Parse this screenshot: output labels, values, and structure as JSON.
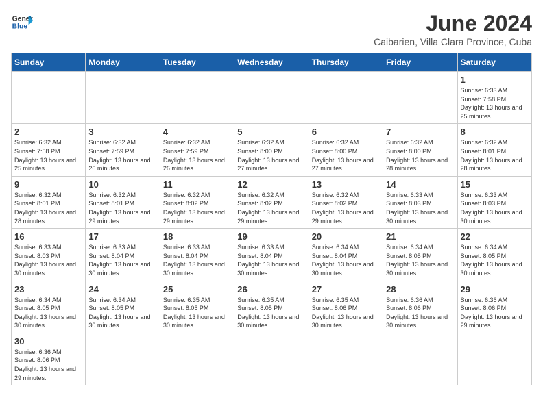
{
  "logo": {
    "text_general": "General",
    "text_blue": "Blue"
  },
  "title": "June 2024",
  "subtitle": "Caibarien, Villa Clara Province, Cuba",
  "days_of_week": [
    "Sunday",
    "Monday",
    "Tuesday",
    "Wednesday",
    "Thursday",
    "Friday",
    "Saturday"
  ],
  "weeks": [
    [
      {
        "day": "",
        "info": ""
      },
      {
        "day": "",
        "info": ""
      },
      {
        "day": "",
        "info": ""
      },
      {
        "day": "",
        "info": ""
      },
      {
        "day": "",
        "info": ""
      },
      {
        "day": "",
        "info": ""
      },
      {
        "day": "1",
        "info": "Sunrise: 6:33 AM\nSunset: 7:58 PM\nDaylight: 13 hours and 25 minutes."
      }
    ],
    [
      {
        "day": "2",
        "info": "Sunrise: 6:32 AM\nSunset: 7:58 PM\nDaylight: 13 hours and 25 minutes."
      },
      {
        "day": "3",
        "info": "Sunrise: 6:32 AM\nSunset: 7:59 PM\nDaylight: 13 hours and 26 minutes."
      },
      {
        "day": "4",
        "info": "Sunrise: 6:32 AM\nSunset: 7:59 PM\nDaylight: 13 hours and 26 minutes."
      },
      {
        "day": "5",
        "info": "Sunrise: 6:32 AM\nSunset: 8:00 PM\nDaylight: 13 hours and 27 minutes."
      },
      {
        "day": "6",
        "info": "Sunrise: 6:32 AM\nSunset: 8:00 PM\nDaylight: 13 hours and 27 minutes."
      },
      {
        "day": "7",
        "info": "Sunrise: 6:32 AM\nSunset: 8:00 PM\nDaylight: 13 hours and 28 minutes."
      },
      {
        "day": "8",
        "info": "Sunrise: 6:32 AM\nSunset: 8:01 PM\nDaylight: 13 hours and 28 minutes."
      }
    ],
    [
      {
        "day": "9",
        "info": "Sunrise: 6:32 AM\nSunset: 8:01 PM\nDaylight: 13 hours and 28 minutes."
      },
      {
        "day": "10",
        "info": "Sunrise: 6:32 AM\nSunset: 8:01 PM\nDaylight: 13 hours and 29 minutes."
      },
      {
        "day": "11",
        "info": "Sunrise: 6:32 AM\nSunset: 8:02 PM\nDaylight: 13 hours and 29 minutes."
      },
      {
        "day": "12",
        "info": "Sunrise: 6:32 AM\nSunset: 8:02 PM\nDaylight: 13 hours and 29 minutes."
      },
      {
        "day": "13",
        "info": "Sunrise: 6:32 AM\nSunset: 8:02 PM\nDaylight: 13 hours and 29 minutes."
      },
      {
        "day": "14",
        "info": "Sunrise: 6:33 AM\nSunset: 8:03 PM\nDaylight: 13 hours and 30 minutes."
      },
      {
        "day": "15",
        "info": "Sunrise: 6:33 AM\nSunset: 8:03 PM\nDaylight: 13 hours and 30 minutes."
      }
    ],
    [
      {
        "day": "16",
        "info": "Sunrise: 6:33 AM\nSunset: 8:03 PM\nDaylight: 13 hours and 30 minutes."
      },
      {
        "day": "17",
        "info": "Sunrise: 6:33 AM\nSunset: 8:04 PM\nDaylight: 13 hours and 30 minutes."
      },
      {
        "day": "18",
        "info": "Sunrise: 6:33 AM\nSunset: 8:04 PM\nDaylight: 13 hours and 30 minutes."
      },
      {
        "day": "19",
        "info": "Sunrise: 6:33 AM\nSunset: 8:04 PM\nDaylight: 13 hours and 30 minutes."
      },
      {
        "day": "20",
        "info": "Sunrise: 6:34 AM\nSunset: 8:04 PM\nDaylight: 13 hours and 30 minutes."
      },
      {
        "day": "21",
        "info": "Sunrise: 6:34 AM\nSunset: 8:05 PM\nDaylight: 13 hours and 30 minutes."
      },
      {
        "day": "22",
        "info": "Sunrise: 6:34 AM\nSunset: 8:05 PM\nDaylight: 13 hours and 30 minutes."
      }
    ],
    [
      {
        "day": "23",
        "info": "Sunrise: 6:34 AM\nSunset: 8:05 PM\nDaylight: 13 hours and 30 minutes."
      },
      {
        "day": "24",
        "info": "Sunrise: 6:34 AM\nSunset: 8:05 PM\nDaylight: 13 hours and 30 minutes."
      },
      {
        "day": "25",
        "info": "Sunrise: 6:35 AM\nSunset: 8:05 PM\nDaylight: 13 hours and 30 minutes."
      },
      {
        "day": "26",
        "info": "Sunrise: 6:35 AM\nSunset: 8:05 PM\nDaylight: 13 hours and 30 minutes."
      },
      {
        "day": "27",
        "info": "Sunrise: 6:35 AM\nSunset: 8:06 PM\nDaylight: 13 hours and 30 minutes."
      },
      {
        "day": "28",
        "info": "Sunrise: 6:36 AM\nSunset: 8:06 PM\nDaylight: 13 hours and 30 minutes."
      },
      {
        "day": "29",
        "info": "Sunrise: 6:36 AM\nSunset: 8:06 PM\nDaylight: 13 hours and 29 minutes."
      }
    ],
    [
      {
        "day": "30",
        "info": "Sunrise: 6:36 AM\nSunset: 8:06 PM\nDaylight: 13 hours and 29 minutes."
      },
      {
        "day": "",
        "info": ""
      },
      {
        "day": "",
        "info": ""
      },
      {
        "day": "",
        "info": ""
      },
      {
        "day": "",
        "info": ""
      },
      {
        "day": "",
        "info": ""
      },
      {
        "day": "",
        "info": ""
      }
    ]
  ]
}
